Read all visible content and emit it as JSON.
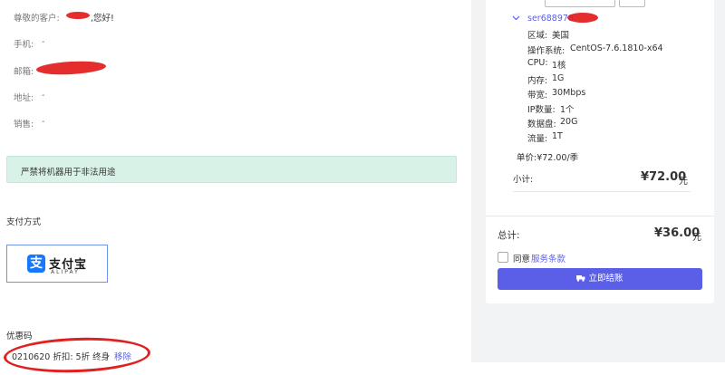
{
  "customer": {
    "greeting_prefix": "尊敬的客户:",
    "greeting_suffix": ",您好!",
    "phone_label": "手机:",
    "phone_value": "-",
    "email_label": "邮箱:",
    "address_label": "地址:",
    "address_value": "-",
    "sales_label": "销售:",
    "sales_value": "-"
  },
  "notice": "严禁将机器用于非法用途",
  "payment": {
    "label": "支付方式",
    "alipay_cn": "支付宝",
    "alipay_en": "ALIPAY",
    "alipay_glyph": "支"
  },
  "coupon": {
    "label": "优惠码",
    "code_text": "0210620 折扣: 5折 终身",
    "remove": "移除"
  },
  "order": {
    "product_name": "ser688978",
    "specs": [
      {
        "label": "区域:",
        "value": "美国"
      },
      {
        "label": "操作系统:",
        "value": "CentOS-7.6.1810-x64"
      },
      {
        "label": "CPU:",
        "value": "1核"
      },
      {
        "label": "内存:",
        "value": "1G"
      },
      {
        "label": "带宽:",
        "value": "30Mbps"
      },
      {
        "label": "IP数量:",
        "value": "1个"
      },
      {
        "label": "数据盘:",
        "value": "20G"
      },
      {
        "label": "流量:",
        "value": "1T"
      }
    ],
    "unit_price": "单价:¥72.00/季",
    "subtotal_label": "小计:",
    "subtotal_value": "¥72.00",
    "currency_unit": "元",
    "total_label": "总计:",
    "total_value": "¥36.00",
    "agree_prefix": "同意",
    "agree_link": "服务条款",
    "checkout": "立即结账",
    "checkout_icon": "truck-icon",
    "accent": "#5b5fe8"
  }
}
